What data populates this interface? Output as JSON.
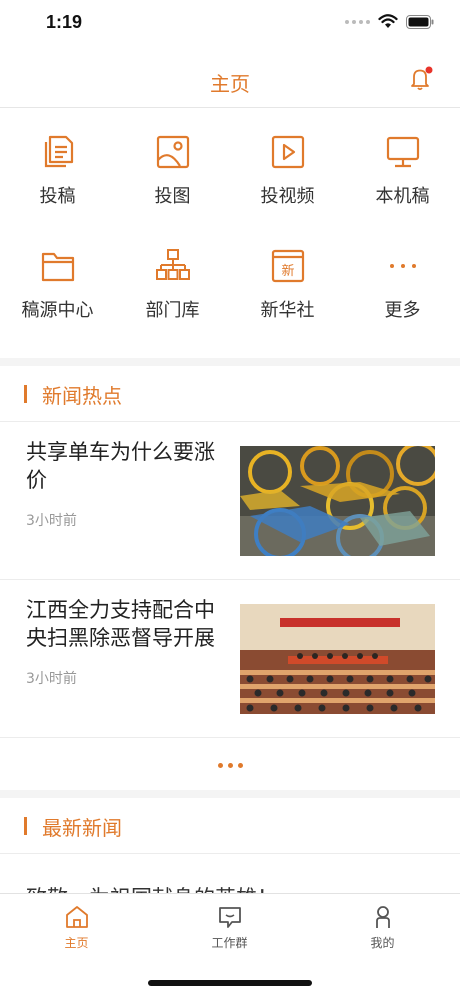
{
  "status_bar": {
    "time": "1:19"
  },
  "nav": {
    "title": "主页",
    "notification_dot_color": "#e8332a"
  },
  "grid": [
    {
      "label": "投稿",
      "icon": "document-icon"
    },
    {
      "label": "投图",
      "icon": "image-icon"
    },
    {
      "label": "投视频",
      "icon": "video-icon"
    },
    {
      "label": "本机稿",
      "icon": "monitor-icon"
    },
    {
      "label": "稿源中心",
      "icon": "folder-icon"
    },
    {
      "label": "部门库",
      "icon": "org-chart-icon"
    },
    {
      "label": "新华社",
      "icon": "xinhua-icon",
      "glyph": "新"
    },
    {
      "label": "更多",
      "icon": "more-icon"
    }
  ],
  "hot_news": {
    "title": "新闻热点",
    "items": [
      {
        "title": "共享单车为什么要涨价",
        "time": "3小时前",
        "image": "shared-bikes-photo"
      },
      {
        "title": "江西全力支持配合中央扫黑除恶督导开展",
        "time": "3小时前",
        "image": "conference-photo"
      }
    ]
  },
  "latest_news": {
    "title": "最新新闻",
    "peek_text": "致敬，为祖国献身的英雄！"
  },
  "tabs": [
    {
      "label": "主页",
      "icon": "home-icon",
      "active": true
    },
    {
      "label": "工作群",
      "icon": "chat-icon",
      "active": false
    },
    {
      "label": "我的",
      "icon": "profile-icon",
      "active": false
    }
  ],
  "colors": {
    "accent": "#e07a2c",
    "text": "#333333",
    "muted": "#999999"
  }
}
